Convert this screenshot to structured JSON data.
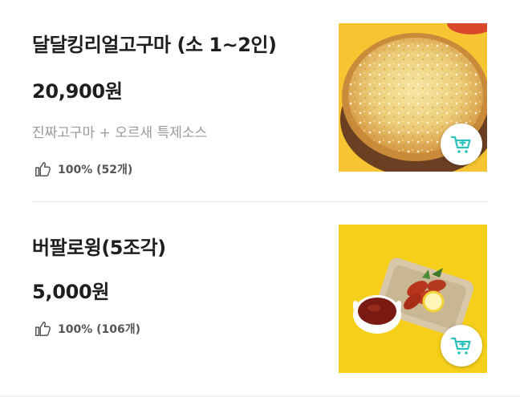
{
  "items": [
    {
      "name": "달달킹리얼고구마 (소 1~2인)",
      "price": "20,900원",
      "description": "진짜고구마 + 오르새 특제소스",
      "rating": "100% (52개)",
      "image_icon": "pizza-photo",
      "cart_icon": "add-to-cart-icon"
    },
    {
      "name": "버팔로윙(5조각)",
      "price": "5,000원",
      "rating": "100% (106개)",
      "image_icon": "wings-photo",
      "cart_icon": "add-to-cart-icon"
    }
  ],
  "colors": {
    "accent": "#2ac1bc",
    "title": "#1e1e1e",
    "description": "#9a9a9a",
    "rating": "#555555",
    "pizza_bg": "#f7c531",
    "wings_bg": "#f6cf1a"
  }
}
